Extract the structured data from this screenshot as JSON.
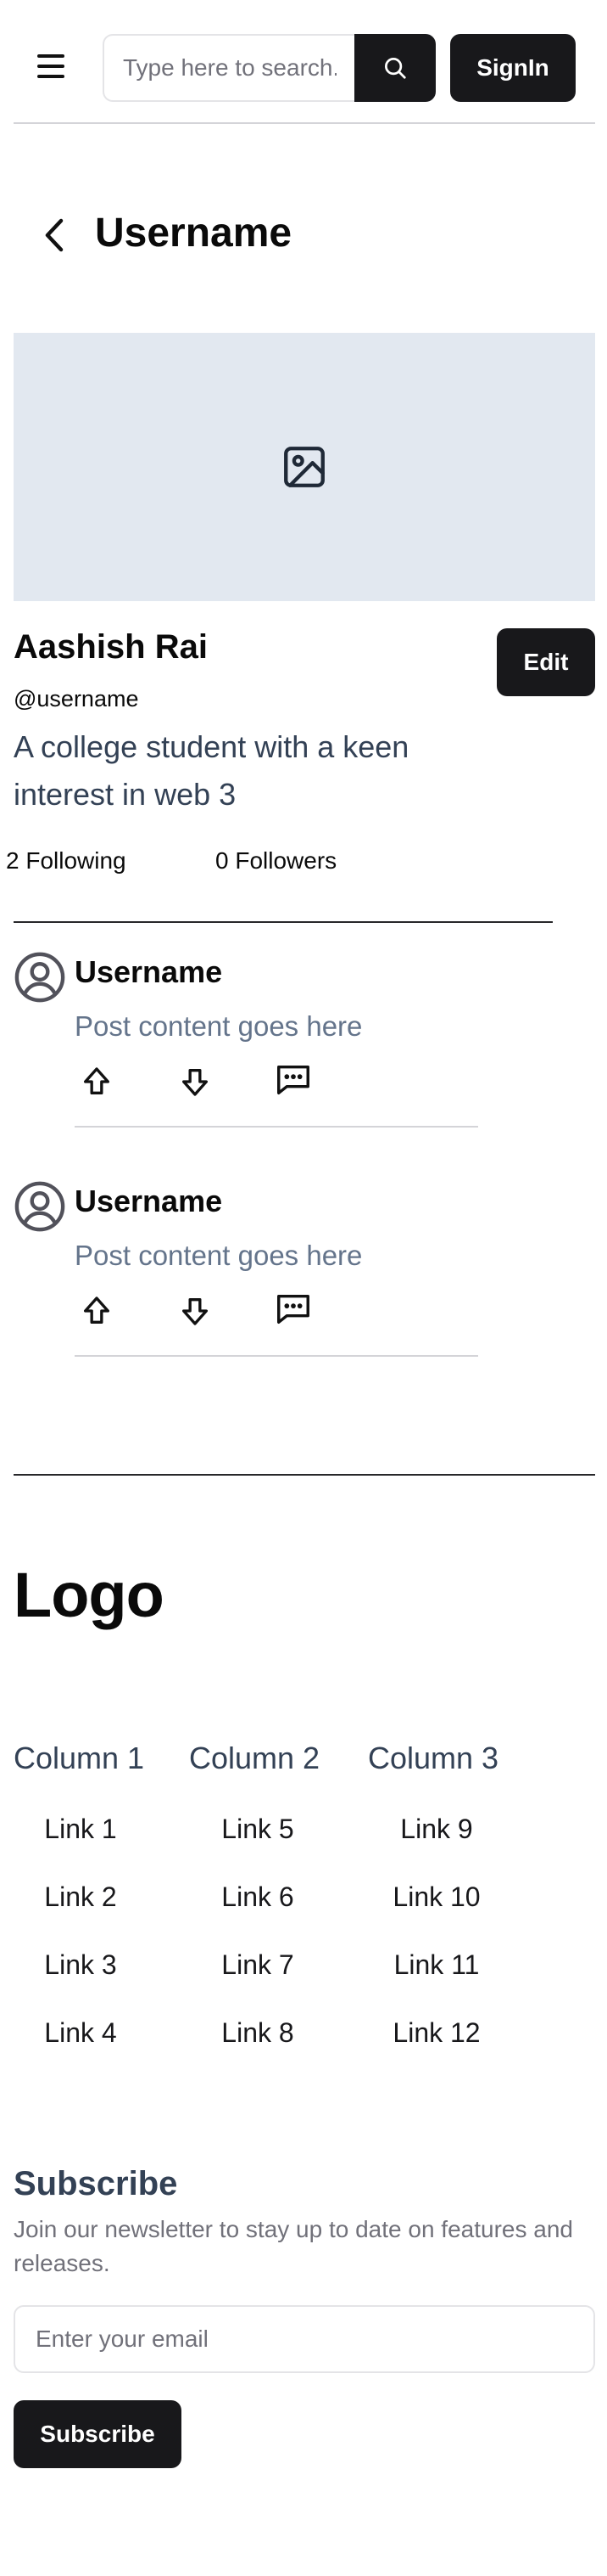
{
  "header": {
    "search_placeholder": "Type here to search...",
    "signin_label": "SignIn"
  },
  "profile": {
    "page_title": "Username",
    "name": "Aashish Rai",
    "handle": "@username",
    "edit_label": "Edit",
    "bio": "A college student with a keen interest in web 3",
    "following": "2 Following",
    "followers": "0 Followers"
  },
  "posts": [
    {
      "username": "Username",
      "content": "Post content goes here"
    },
    {
      "username": "Username",
      "content": "Post content goes here"
    }
  ],
  "footer": {
    "logo": "Logo",
    "columns": [
      {
        "title": "Column 1",
        "links": [
          "Link 1",
          "Link 2",
          "Link 3",
          "Link 4"
        ]
      },
      {
        "title": "Column 2",
        "links": [
          "Link 5",
          "Link 6",
          "Link 7",
          "Link 8"
        ]
      },
      {
        "title": "Column 3",
        "links": [
          "Link 9",
          "Link 10",
          "Link 11",
          "Link 12"
        ]
      }
    ],
    "subscribe": {
      "title": "Subscribe",
      "description": "Join our newsletter to stay up to date on features and releases.",
      "email_placeholder": "Enter your email",
      "button_label": "Subscribe"
    }
  },
  "icons": {
    "menu": "menu-icon",
    "search": "search-icon",
    "back": "chevron-left-icon",
    "banner": "image-placeholder-icon",
    "avatar": "user-circle-icon",
    "upvote": "arrow-up-icon",
    "downvote": "arrow-down-icon",
    "comment": "comment-icon"
  },
  "colors": {
    "primary": "#18181b",
    "banner_bg": "#e2e8f0",
    "muted_text": "#64748b",
    "heading_slate": "#334155"
  }
}
